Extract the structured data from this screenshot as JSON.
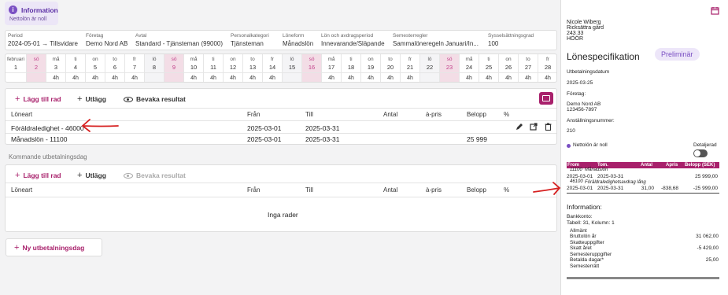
{
  "info": {
    "title": "Information",
    "subtitle": "Nettolön är noll"
  },
  "period_fields": [
    {
      "label": "Period",
      "value": "2024-05-01 → Tillsvidare"
    },
    {
      "label": "Företag",
      "value": "Demo Nord AB"
    },
    {
      "label": "Avtal",
      "value": "Standard - Tjänsteman (99000)"
    },
    {
      "label": "Personalkategori",
      "value": "Tjänsteman"
    },
    {
      "label": "Löneform",
      "value": "Månadslön"
    },
    {
      "label": "Lön och avdragsperiod",
      "value": "Innevarande/Släpande"
    },
    {
      "label": "Semesterregler",
      "value": "Sammalöneregeln Januari/In..."
    },
    {
      "label": "Sysselsättningsgrad",
      "value": "100"
    }
  ],
  "calendar": {
    "month_label": "februari",
    "days": [
      {
        "d": "",
        "n": "1",
        "h": "",
        "we": false,
        "su": false,
        "sel": false
      },
      {
        "d": "sö",
        "n": "2",
        "h": "",
        "we": true,
        "su": true,
        "sel": true
      },
      {
        "d": "må",
        "n": "3",
        "h": "4h",
        "we": false,
        "su": false,
        "sel": false
      },
      {
        "d": "ti",
        "n": "4",
        "h": "4h",
        "we": false,
        "su": false,
        "sel": false
      },
      {
        "d": "on",
        "n": "5",
        "h": "4h",
        "we": false,
        "su": false,
        "sel": false
      },
      {
        "d": "to",
        "n": "6",
        "h": "4h",
        "we": false,
        "su": false,
        "sel": false
      },
      {
        "d": "fr",
        "n": "7",
        "h": "4h",
        "we": false,
        "su": false,
        "sel": false
      },
      {
        "d": "lö",
        "n": "8",
        "h": "",
        "we": true,
        "su": false,
        "sel": false
      },
      {
        "d": "sö",
        "n": "9",
        "h": "",
        "we": true,
        "su": true,
        "sel": true
      },
      {
        "d": "må",
        "n": "10",
        "h": "4h",
        "we": false,
        "su": false,
        "sel": false
      },
      {
        "d": "ti",
        "n": "11",
        "h": "4h",
        "we": false,
        "su": false,
        "sel": false
      },
      {
        "d": "on",
        "n": "12",
        "h": "4h",
        "we": false,
        "su": false,
        "sel": false
      },
      {
        "d": "to",
        "n": "13",
        "h": "4h",
        "we": false,
        "su": false,
        "sel": false
      },
      {
        "d": "fr",
        "n": "14",
        "h": "4h",
        "we": false,
        "su": false,
        "sel": false
      },
      {
        "d": "lö",
        "n": "15",
        "h": "",
        "we": true,
        "su": false,
        "sel": false
      },
      {
        "d": "sö",
        "n": "16",
        "h": "",
        "we": true,
        "su": true,
        "sel": true
      },
      {
        "d": "må",
        "n": "17",
        "h": "4h",
        "we": false,
        "su": false,
        "sel": false
      },
      {
        "d": "ti",
        "n": "18",
        "h": "4h",
        "we": false,
        "su": false,
        "sel": false
      },
      {
        "d": "on",
        "n": "19",
        "h": "4h",
        "we": false,
        "su": false,
        "sel": false
      },
      {
        "d": "to",
        "n": "20",
        "h": "4h",
        "we": false,
        "su": false,
        "sel": false
      },
      {
        "d": "fr",
        "n": "21",
        "h": "4h",
        "we": false,
        "su": false,
        "sel": false
      },
      {
        "d": "lö",
        "n": "22",
        "h": "",
        "we": true,
        "su": false,
        "sel": false
      },
      {
        "d": "sö",
        "n": "23",
        "h": "",
        "we": true,
        "su": true,
        "sel": true
      },
      {
        "d": "må",
        "n": "24",
        "h": "4h",
        "we": false,
        "su": false,
        "sel": false
      },
      {
        "d": "ti",
        "n": "25",
        "h": "4h",
        "we": false,
        "su": false,
        "sel": false
      },
      {
        "d": "on",
        "n": "26",
        "h": "4h",
        "we": false,
        "su": false,
        "sel": false
      },
      {
        "d": "to",
        "n": "27",
        "h": "4h",
        "we": false,
        "su": false,
        "sel": false
      },
      {
        "d": "fr",
        "n": "28",
        "h": "4h",
        "we": false,
        "su": false,
        "sel": false
      }
    ]
  },
  "toolbar": {
    "add_row": "Lägg till rad",
    "outlay": "Utlägg",
    "keep_result": "Bevaka resultat"
  },
  "columns": {
    "type": "Löneart",
    "from": "Från",
    "to": "Till",
    "qty": "Antal",
    "unit_price": "à-pris",
    "amount": "Belopp",
    "percent": "%"
  },
  "rows": [
    {
      "type": "Föräldraledighet - 46000",
      "from": "2025-03-01",
      "to": "2025-03-31",
      "amount": ""
    },
    {
      "type": "Månadslön - 11100",
      "from": "2025-03-01",
      "to": "2025-03-31",
      "amount": "25 999"
    }
  ],
  "upcoming": {
    "label": "Kommande utbetalningsdag",
    "empty": "Inga rader",
    "new_day": "Ny utbetalningsdag"
  },
  "icons": {
    "pencil": "pencil-icon",
    "open": "external-link-icon",
    "trash": "trash-icon",
    "calendar": "calendar-icon"
  },
  "colors": {
    "brand": "#a8206b",
    "accent": "#7a4fc3",
    "annotation": "#d62020"
  },
  "slip": {
    "address": [
      "Nicole Wiberg",
      "Ricksättra gård",
      "243 33",
      "HÖÖR"
    ],
    "title": "Lönespecifikation",
    "badge": "Preliminär",
    "pay_date_label": "Utbetalningsdatum",
    "pay_date": "2025-03-25",
    "company_label": "Företag:",
    "company": [
      "Demo Nord AB",
      "123456-7897"
    ],
    "emp_no_label": "Anställningsnummer:",
    "emp_no": "210",
    "net_note": "Nettolön är noll",
    "detail_label": "Detaljerad",
    "table_headers": {
      "from": "From",
      "to": "Tom.",
      "qty": "Antal",
      "price": "Apris",
      "amount": "Belopp (SEK)"
    },
    "lines": [
      {
        "code": "11100",
        "name": "Månadslön",
        "from": "2025-03-01",
        "to": "2025-03-31",
        "qty": "",
        "price": "",
        "amount": "25 999,00"
      },
      {
        "code": "46100",
        "name": "Föräldraledighetsavdrag lång",
        "from": "2025-03-01",
        "to": "2025-03-31",
        "qty": "31,00",
        "price": "-838,68",
        "amount": "-25 999,00"
      }
    ],
    "info_title": "Information:",
    "bank_label": "Bankkonto:",
    "bank_value": "Tabell: 31, Kolumn: 1",
    "general_label": "Allmänt",
    "stats": [
      {
        "label": "Bruttolön år",
        "value": "31 062,00"
      },
      {
        "label": "Skatteuppgifter",
        "value": ""
      },
      {
        "label": "Skatt året",
        "value": "-5 429,00"
      },
      {
        "label": "Semesteruppgifter",
        "value": ""
      },
      {
        "label": "Betalda dagar*",
        "value": "25,00"
      },
      {
        "label": "Semesterrätt",
        "value": ""
      }
    ]
  }
}
